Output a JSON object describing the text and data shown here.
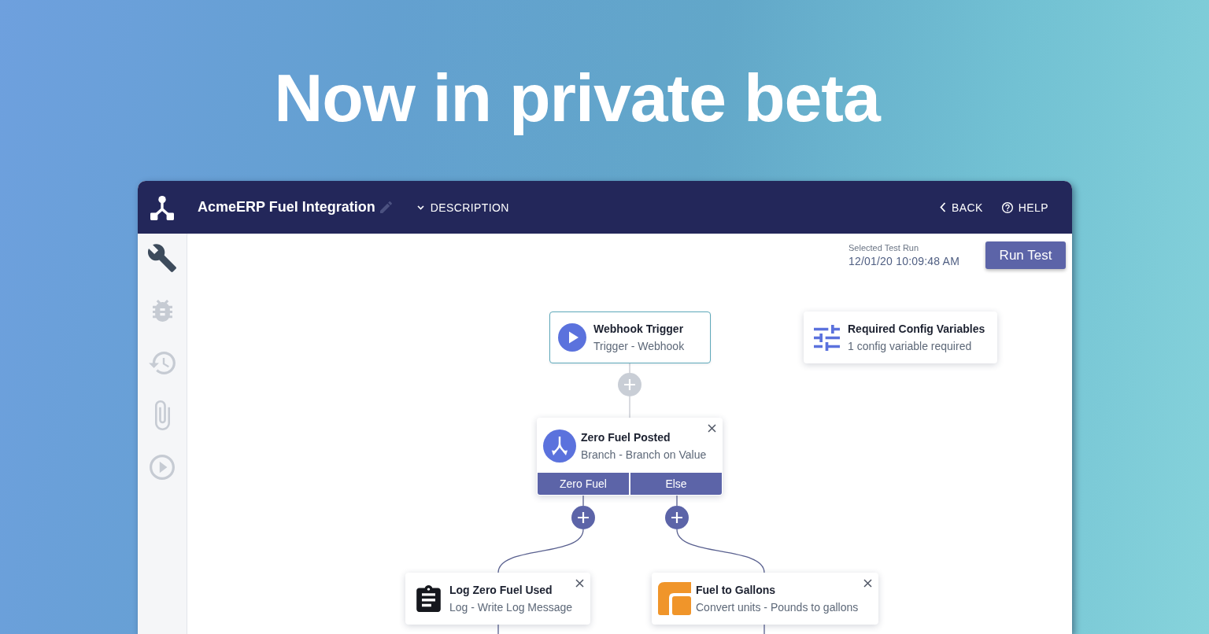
{
  "headline": "Now in private beta",
  "header": {
    "title": "AcmeERP Fuel Integration",
    "description": "DESCRIPTION",
    "actions": [
      {
        "kind": "back",
        "label": "BACK"
      },
      {
        "kind": "help",
        "label": "HELP"
      }
    ]
  },
  "sidebar": {
    "items": [
      {
        "kind": "wrench",
        "selected": true
      },
      {
        "kind": "bug",
        "selected": false
      },
      {
        "kind": "history",
        "selected": false
      },
      {
        "kind": "paperclip",
        "selected": false
      },
      {
        "kind": "play",
        "selected": false
      }
    ]
  },
  "test_run": {
    "label": "Selected Test Run",
    "value": "12/01/20 10:09:48 AM"
  },
  "run_button": "Run Test",
  "config_card": {
    "title": "Required Config Variables",
    "subtitle": "1 config variable required"
  },
  "steps": [
    {
      "kind": "trigger",
      "title": "Webhook Trigger",
      "subtitle": "Trigger - Webhook",
      "selected": true,
      "removable": false
    },
    {
      "kind": "branch",
      "title": "Zero Fuel Posted",
      "subtitle": "Branch - Branch on Value",
      "selected": false,
      "removable": true,
      "branches": [
        "Zero Fuel",
        "Else"
      ]
    },
    {
      "kind": "log",
      "title": "Log Zero Fuel Used",
      "subtitle": "Log - Write Log Message",
      "selected": false,
      "removable": true
    },
    {
      "kind": "convert",
      "title": "Fuel to Gallons",
      "subtitle": "Convert units - Pounds to gallons",
      "selected": false,
      "removable": true
    }
  ],
  "add_buttons": [
    {
      "disabled": true
    },
    {
      "disabled": false
    },
    {
      "disabled": false
    }
  ]
}
